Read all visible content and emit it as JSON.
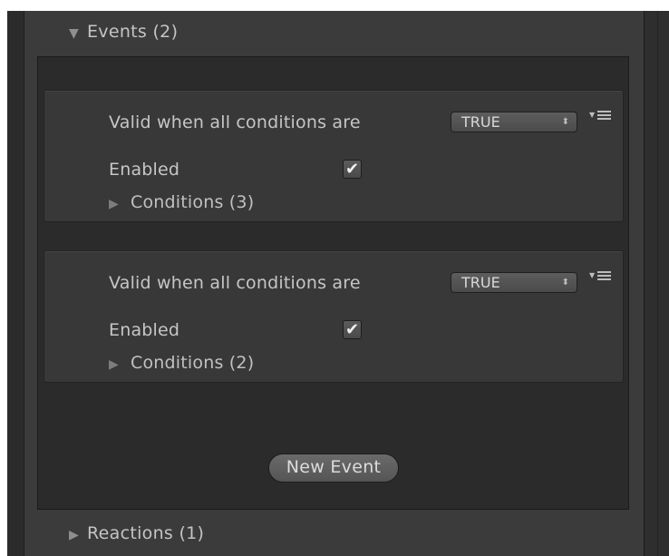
{
  "events_foldout": {
    "arrow": "▼",
    "label": "Events (2)"
  },
  "events": [
    {
      "valid_label": "Valid when all conditions are",
      "valid_value": "TRUE",
      "enabled_label": "Enabled",
      "enabled_checked": true,
      "enabled_mark": "✔",
      "conditions_arrow": "▶",
      "conditions_label": "Conditions (3)"
    },
    {
      "valid_label": "Valid when all conditions are",
      "valid_value": "TRUE",
      "enabled_label": "Enabled",
      "enabled_checked": true,
      "enabled_mark": "✔",
      "conditions_arrow": "▶",
      "conditions_label": "Conditions (2)"
    }
  ],
  "dropdown_spinner": "⬍",
  "new_event_label": "New Event",
  "reactions_foldout": {
    "arrow": "▶",
    "label": "Reactions (1)"
  },
  "icons": {
    "foldout_open": "triangle-down-icon",
    "foldout_closed": "triangle-right-icon",
    "context_menu": "context-menu-icon",
    "check": "checkmark-icon"
  },
  "colors": {
    "panel": "#3b3b3b",
    "list_background": "#2b2b2b",
    "item_background": "#383838",
    "text": "#c6c6c6"
  }
}
